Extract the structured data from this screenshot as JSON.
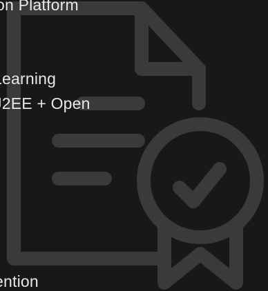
{
  "background": {
    "page_color": "#181818",
    "icon_name": "certificate-document-icon",
    "icon_color": "#3a3a3a"
  },
  "text_lines": [
    "on Platform",
    "Learning",
    "J2EE + Open",
    "ention"
  ],
  "text_color": "#e8e8e8"
}
